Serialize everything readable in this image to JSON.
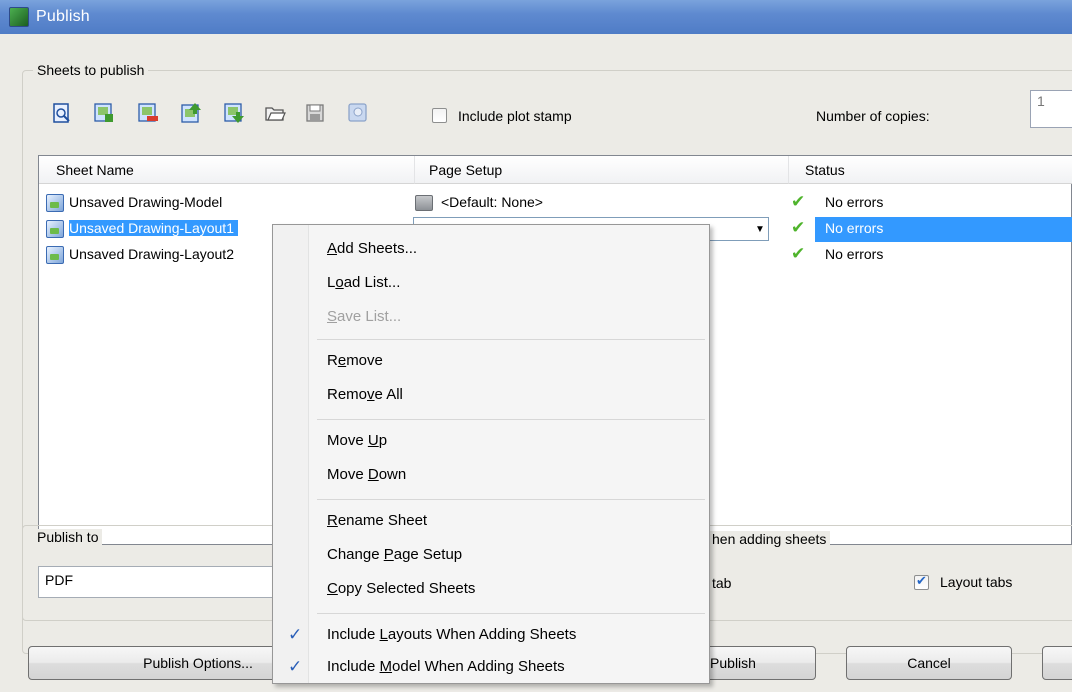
{
  "window": {
    "title": "Publish"
  },
  "sheets_group": {
    "label": "Sheets to publish",
    "include_plot_stamp": {
      "label": "Include plot stamp",
      "checked": false
    },
    "copies": {
      "label": "Number of copies:",
      "value": "1"
    },
    "toolbar": [
      "preview-icon",
      "add-sheets-icon",
      "remove-sheets-icon",
      "move-up-icon",
      "move-down-icon",
      "load-list-icon",
      "save-list-icon",
      "plot-stamp-settings-icon"
    ]
  },
  "list": {
    "columns": [
      "Sheet Name",
      "Page Setup",
      "Status"
    ],
    "rows": [
      {
        "name": "Unsaved Drawing-Model",
        "page_setup": "<Default: None>",
        "status": "No errors"
      },
      {
        "name": "Unsaved Drawing-Layout1",
        "page_setup": "",
        "status": "No errors"
      },
      {
        "name": "Unsaved Drawing-Layout2",
        "page_setup": "",
        "status": "No errors"
      }
    ]
  },
  "publish_to": {
    "label": "Publish to",
    "value": "PDF"
  },
  "adding_sheets": {
    "label": "hen adding sheets",
    "model_tab_label": "tab",
    "layout_tabs_label": "Layout tabs",
    "layout_tabs_checked": true
  },
  "buttons": {
    "publish_options": "Publish Options...",
    "publish": "Publish",
    "cancel": "Cancel"
  },
  "context_menu": {
    "items": [
      {
        "pre": "",
        "u": "A",
        "post": "dd Sheets...",
        "enabled": true
      },
      {
        "pre": "L",
        "u": "o",
        "post": "ad List...",
        "enabled": true
      },
      {
        "pre": "",
        "u": "S",
        "post": "ave List...",
        "enabled": false
      },
      {
        "pre": "R",
        "u": "e",
        "post": "move",
        "enabled": true
      },
      {
        "pre": "Remo",
        "u": "v",
        "post": "e All",
        "enabled": true
      },
      {
        "pre": "Move ",
        "u": "U",
        "post": "p",
        "enabled": true
      },
      {
        "pre": "Move ",
        "u": "D",
        "post": "own",
        "enabled": true
      },
      {
        "pre": "",
        "u": "R",
        "post": "ename Sheet",
        "enabled": true
      },
      {
        "pre": "Change ",
        "u": "P",
        "post": "age Setup",
        "enabled": true
      },
      {
        "pre": "",
        "u": "C",
        "post": "opy Selected Sheets",
        "enabled": true
      },
      {
        "pre": "Include ",
        "u": "L",
        "post": "ayouts When Adding Sheets",
        "enabled": true,
        "checked": true
      },
      {
        "pre": "Include ",
        "u": "M",
        "post": "odel When Adding Sheets",
        "enabled": true,
        "checked": true
      }
    ]
  },
  "colors": {
    "title_bar": "#5f8ad0",
    "selection": "#3399ff",
    "dialog_bg": "#ecebe6",
    "status_check": "#4fb42c"
  }
}
